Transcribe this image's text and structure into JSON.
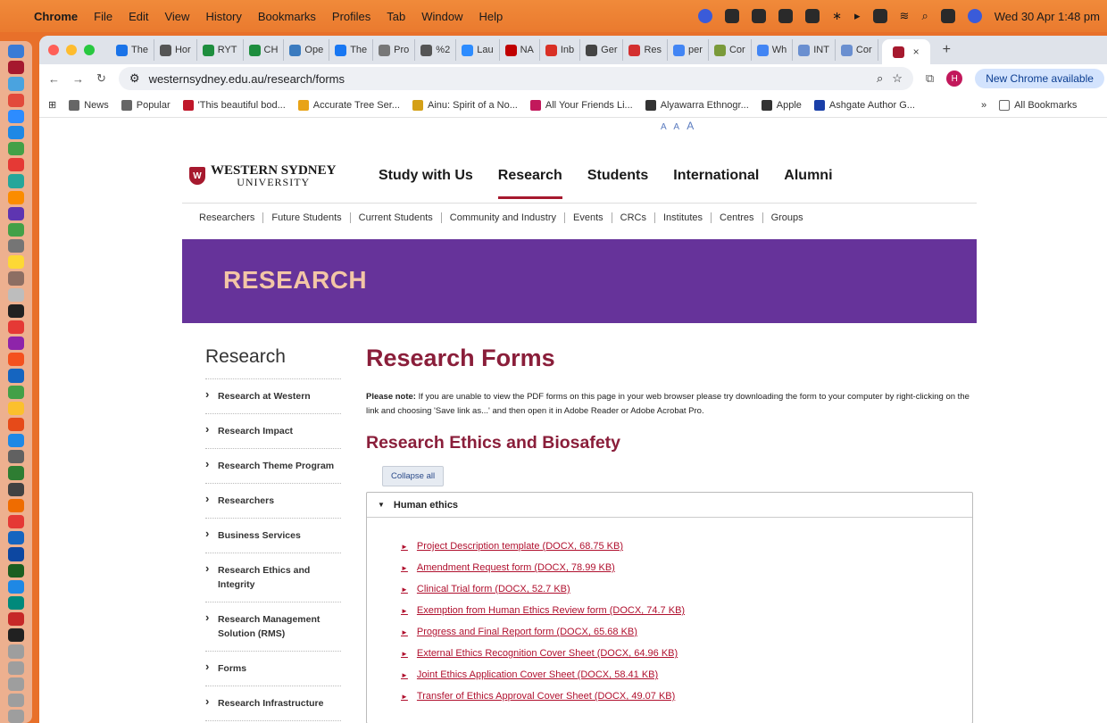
{
  "menubar": {
    "app": "Chrome",
    "menus": [
      "File",
      "Edit",
      "View",
      "History",
      "Bookmarks",
      "Profiles",
      "Tab",
      "Window",
      "Help"
    ],
    "clock": "Wed 30 Apr  1:48 pm"
  },
  "tabs": [
    {
      "label": "The",
      "color": "#1a73e8"
    },
    {
      "label": "Hor",
      "color": "#555555"
    },
    {
      "label": "RYT",
      "color": "#1e8e3e"
    },
    {
      "label": "CH",
      "color": "#1e8e3e"
    },
    {
      "label": "Ope",
      "color": "#3b7bbf"
    },
    {
      "label": "The",
      "color": "#1877f2"
    },
    {
      "label": "Pro",
      "color": "#777777"
    },
    {
      "label": "%2",
      "color": "#555555"
    },
    {
      "label": "Lau",
      "color": "#2d8cff"
    },
    {
      "label": "NA",
      "color": "#c00000"
    },
    {
      "label": "Inb",
      "color": "#d93025"
    },
    {
      "label": "Ger",
      "color": "#444444"
    },
    {
      "label": "Res",
      "color": "#d32f2f"
    },
    {
      "label": "per",
      "color": "#4285f4"
    },
    {
      "label": "Cor",
      "color": "#7a9a3a"
    },
    {
      "label": "Wh",
      "color": "#4285f4"
    },
    {
      "label": "INT",
      "color": "#6a8fd0"
    },
    {
      "label": "Cor",
      "color": "#6a8fd0"
    }
  ],
  "active_tab": {
    "close": "×",
    "new": "+"
  },
  "address_bar": {
    "url": "westernsydney.edu.au/research/forms",
    "profile_initial": "H",
    "update_label": "New Chrome available"
  },
  "bookmarks": [
    {
      "label": "News",
      "color": "#666666"
    },
    {
      "label": "Popular",
      "color": "#666666"
    },
    {
      "label": "'This beautiful bod...",
      "color": "#c0172a"
    },
    {
      "label": "Accurate Tree Ser...",
      "color": "#e8a317"
    },
    {
      "label": "Ainu: Spirit of a No...",
      "color": "#d4a017"
    },
    {
      "label": "All Your Friends Li...",
      "color": "#c2185b"
    },
    {
      "label": "Alyawarra Ethnogr...",
      "color": "#333333"
    },
    {
      "label": "Apple",
      "color": "#333333"
    },
    {
      "label": "Ashgate Author G...",
      "color": "#1a3fa8"
    }
  ],
  "bookmarks_right": {
    "overflow": "»",
    "all": "All Bookmarks"
  },
  "font_sizer": [
    "A",
    "A",
    "A"
  ],
  "site": {
    "logo_line1": "WESTERN SYDNEY",
    "logo_line2": "UNIVERSITY",
    "logo_mark": "W",
    "main_nav": [
      "Study with Us",
      "Research",
      "Students",
      "International",
      "Alumni"
    ],
    "sub_nav": [
      "Researchers",
      "Future Students",
      "Current Students",
      "Community and Industry",
      "Events",
      "CRCs",
      "Institutes",
      "Centres",
      "Groups"
    ],
    "banner": "RESEARCH"
  },
  "sidebar": {
    "title": "Research",
    "items": [
      "Research at Western",
      "Research Impact",
      "Research Theme Program",
      "Researchers",
      "Business Services",
      "Research Ethics and Integrity",
      "Research Management Solution (RMS)",
      "Forms",
      "Research Infrastructure"
    ]
  },
  "content": {
    "title": "Research Forms",
    "note_label": "Please note:",
    "note_text": " If you are unable to view the PDF forms on this page in your web browser please try downloading the form to your computer by right-clicking on the link and choosing 'Save link as...' and then open it in Adobe Reader or Adobe Acrobat Pro.",
    "section": "Research Ethics and Biosafety",
    "collapse": "Collapse all",
    "accordion_title": "Human ethics",
    "links": [
      "Project Description template (DOCX, 68.75 KB)",
      "Amendment Request form (DOCX, 78.99 KB)",
      "Clinical Trial form (DOCX, 52.7 KB)",
      "Exemption from Human Ethics Review form (DOCX, 74.7 KB)",
      "Progress and Final Report form (DOCX, 65.68 KB)",
      "External Ethics Recognition Cover Sheet (DOCX, 64.96 KB)",
      "Joint Ethics Application Cover Sheet (DOCX, 58.41 KB)",
      "Transfer of Ethics Approval Cover Sheet (DOCX, 49.07 KB)"
    ]
  }
}
